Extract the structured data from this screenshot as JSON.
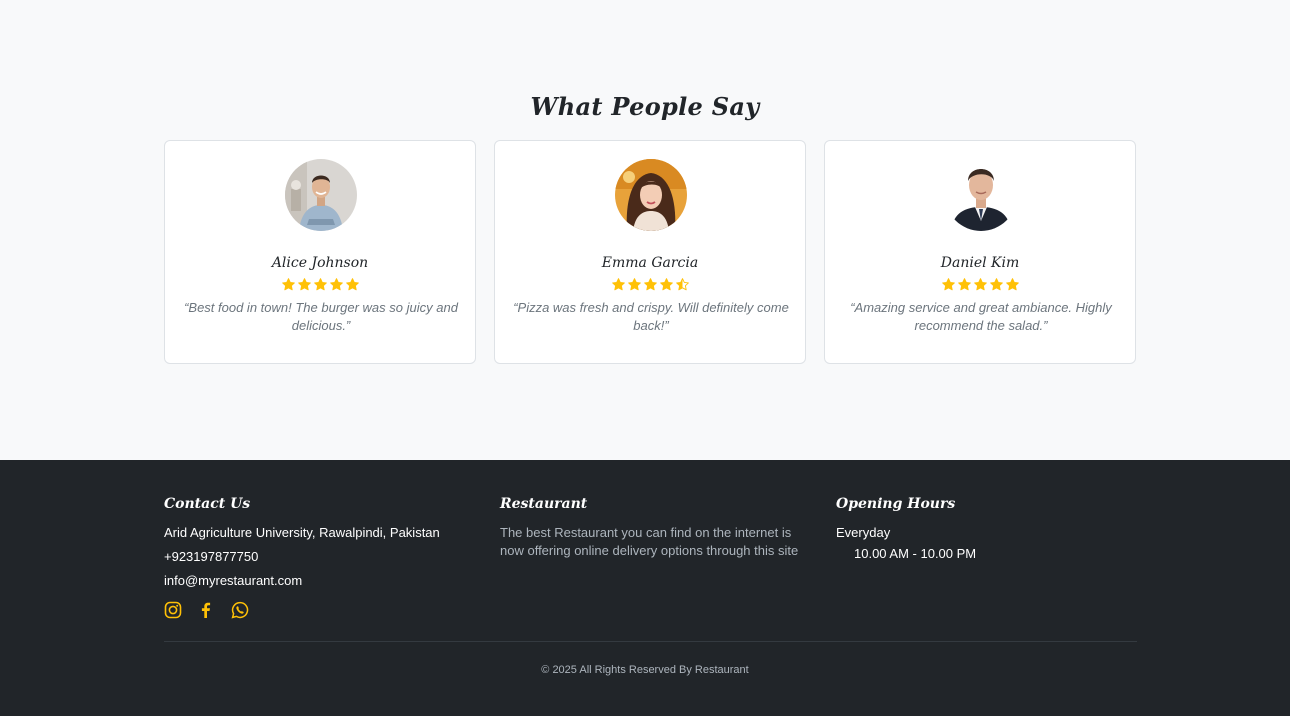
{
  "testimonials": {
    "title": "What People Say",
    "items": [
      {
        "name": "Alice Johnson",
        "rating": 5,
        "quote": "“Best food in town! The burger was so juicy and delicious.”"
      },
      {
        "name": "Emma Garcia",
        "rating": 4.5,
        "quote": "“Pizza was fresh and crispy. Will definitely come back!”"
      },
      {
        "name": "Daniel Kim",
        "rating": 5,
        "quote": "“Amazing service and great ambiance. Highly recommend the salad.”"
      }
    ]
  },
  "footer": {
    "contact": {
      "heading": "Contact Us",
      "address": "Arid Agriculture University, Rawalpindi, Pakistan",
      "phone": "+923197877750",
      "email": "info@myrestaurant.com",
      "socials": [
        "instagram-icon",
        "facebook-icon",
        "whatsapp-icon"
      ]
    },
    "about": {
      "heading": "Restaurant",
      "text": "The best Restaurant you can find on the internet is now offering online delivery options through this site"
    },
    "hours": {
      "heading": "Opening Hours",
      "day": "Everyday",
      "time": "10.00 AM - 10.00 PM"
    },
    "copyright": "© 2025 All Rights Reserved By Restaurant"
  },
  "colors": {
    "accent": "#ffc107",
    "footer_bg": "#212529",
    "page_bg": "#f8f9fa"
  }
}
